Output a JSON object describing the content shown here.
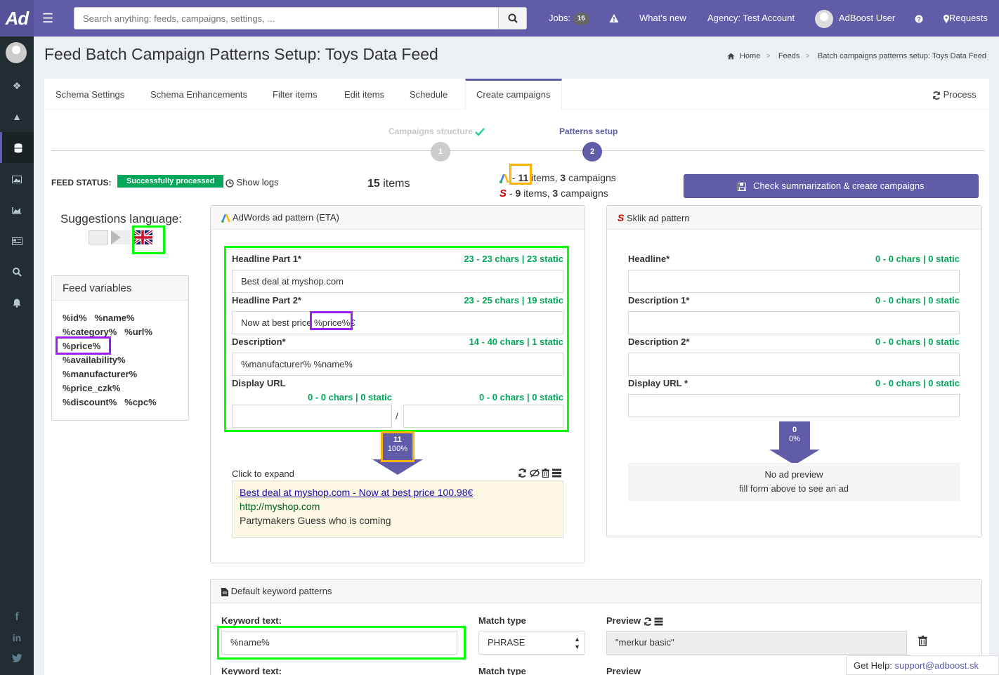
{
  "header": {
    "logo": "Ad",
    "search_placeholder": "Search anything: feeds, campaigns, settings, ...",
    "jobs_label": "Jobs:",
    "jobs_count": "16",
    "whats_new": "What's new",
    "agency": "Agency: Test Account",
    "user": "AdBoost User",
    "requests": "Requests"
  },
  "page": {
    "title": "Feed Batch Campaign Patterns Setup: Toys Data Feed",
    "breadcrumb": [
      "Home",
      "Feeds",
      "Batch campaigns patterns setup: Toys Data Feed"
    ]
  },
  "tabs": [
    "Schema Settings",
    "Schema Enhancements",
    "Filter items",
    "Edit items",
    "Schedule",
    "Create campaigns"
  ],
  "process_label": "Process",
  "steps": [
    {
      "label": "Campaigns structure",
      "number": "1"
    },
    {
      "label": "Patterns setup",
      "number": "2"
    }
  ],
  "status": {
    "feed_status_label": "FEED STATUS:",
    "feed_status_value": "Successfully processed",
    "show_logs": "Show logs",
    "items_count": "15",
    "items_word": "items",
    "adwords_items": "11",
    "adwords_campaigns": "3",
    "sklik_items": "9",
    "sklik_campaigns": "3",
    "items_text": "items,",
    "campaigns_text": "campaigns",
    "dash": "-"
  },
  "create_button": "Check summarization & create campaigns",
  "suggestions_language": "Suggestions language:",
  "feed_variables": {
    "title": "Feed variables",
    "rows": [
      [
        "%id%",
        "%name%"
      ],
      [
        "%category%",
        "%url%"
      ],
      [
        "%price%"
      ],
      [
        "%availability%"
      ],
      [
        "%manufacturer%"
      ],
      [
        "%price_czk%"
      ],
      [
        "%discount%",
        "%cpc%"
      ]
    ]
  },
  "adwords": {
    "title": "AdWords ad pattern (ETA)",
    "headline1_label": "Headline Part 1*",
    "headline1_count": "23 - 23 chars | 23 static",
    "headline1_value": "Best deal at myshop.com",
    "headline2_label": "Headline Part 2*",
    "headline2_count": "23 - 25 chars | 19 static",
    "headline2_value": "Now at best price %price%€",
    "description_label": "Description*",
    "description_count": "14 - 40 chars | 1 static",
    "description_value": "%manufacturer% %name%",
    "display_url_label": "Display URL",
    "display_url_count1": "0 - 0 chars | 0 static",
    "display_url_count2": "0 - 0 chars | 0 static",
    "slash": "/",
    "arrow_count": "11",
    "arrow_percent": "100%",
    "click_to_expand": "Click to expand",
    "preview_headline": "Best deal at myshop.com - Now at best price 100.98€",
    "preview_url": "http://myshop.com",
    "preview_description": "Partymakers Guess who is coming"
  },
  "sklik": {
    "title": "Sklik ad pattern",
    "headline_label": "Headline*",
    "headline_count": "0 - 0 chars | 0 static",
    "desc1_label": "Description 1*",
    "desc1_count": "0 - 0 chars | 0 static",
    "desc2_label": "Description 2*",
    "desc2_count": "0 - 0 chars | 0 static",
    "display_url_label": "Display URL *",
    "display_url_count": "0 - 0 chars | 0 static",
    "arrow_count": "0",
    "arrow_percent": "0%",
    "no_preview_1": "No ad preview",
    "no_preview_2": "fill form above to see an ad"
  },
  "keywords": {
    "title": "Default keyword patterns",
    "keyword_label": "Keyword text:",
    "keyword_value": "%name%",
    "match_label": "Match type",
    "match_value": "PHRASE",
    "preview_label": "Preview",
    "preview_value": "\"merkur basic\""
  },
  "help": {
    "label": "Get Help:",
    "email": "support@adboost.sk"
  },
  "colors": {
    "brand": "#605ca8",
    "success": "#00a65a",
    "sidebar": "#222d32"
  }
}
